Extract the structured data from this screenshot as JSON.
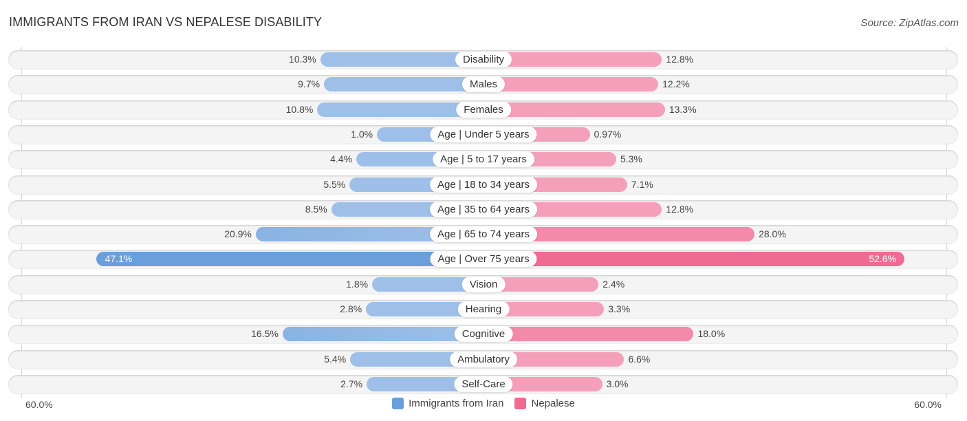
{
  "header": {
    "title": "IMMIGRANTS FROM IRAN VS NEPALESE DISABILITY",
    "source": "Source: ZipAtlas.com"
  },
  "colors": {
    "iran": "#9ec0e8",
    "iran_strong": "#6a9fdb",
    "nepalese": "#f5a0ba",
    "nepalese_strong": "#f06a93"
  },
  "chart_data": {
    "type": "bar",
    "orientation": "horizontal-diverging",
    "title": "IMMIGRANTS FROM IRAN VS NEPALESE DISABILITY",
    "categories": [
      "Disability",
      "Males",
      "Females",
      "Age | Under 5 years",
      "Age | 5 to 17 years",
      "Age | 18 to 34 years",
      "Age | 35 to 64 years",
      "Age | 65 to 74 years",
      "Age | Over 75 years",
      "Vision",
      "Hearing",
      "Cognitive",
      "Ambulatory",
      "Self-Care"
    ],
    "series": [
      {
        "name": "Immigrants from Iran",
        "side": "left",
        "values": [
          10.3,
          9.7,
          10.8,
          1.0,
          4.4,
          5.5,
          8.5,
          20.9,
          47.1,
          1.8,
          2.8,
          16.5,
          5.4,
          2.7
        ],
        "labels": [
          "10.3%",
          "9.7%",
          "10.8%",
          "1.0%",
          "4.4%",
          "5.5%",
          "8.5%",
          "20.9%",
          "47.1%",
          "1.8%",
          "2.8%",
          "16.5%",
          "5.4%",
          "2.7%"
        ]
      },
      {
        "name": "Nepalese",
        "side": "right",
        "values": [
          12.8,
          12.2,
          13.3,
          0.97,
          5.3,
          7.1,
          12.8,
          28.0,
          52.6,
          2.4,
          3.3,
          18.0,
          6.6,
          3.0
        ],
        "labels": [
          "12.8%",
          "12.2%",
          "13.3%",
          "0.97%",
          "5.3%",
          "7.1%",
          "12.8%",
          "28.0%",
          "52.6%",
          "2.4%",
          "3.3%",
          "18.0%",
          "6.6%",
          "3.0%"
        ]
      }
    ],
    "axis": {
      "left_label": "60.0%",
      "right_label": "60.0%",
      "max": 60
    },
    "legend": {
      "position": "bottom-center",
      "items": [
        "Immigrants from Iran",
        "Nepalese"
      ]
    },
    "grid": false
  }
}
